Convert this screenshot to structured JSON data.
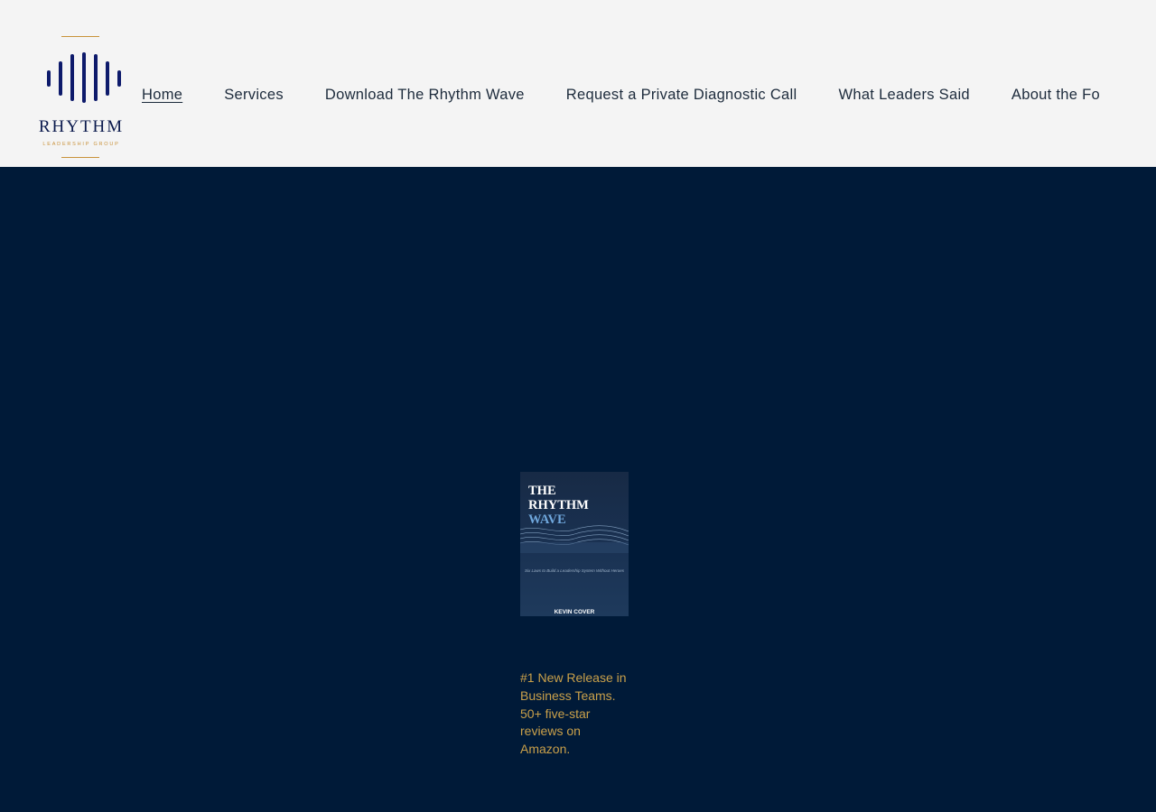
{
  "header": {
    "logo": {
      "wordmark": "RHYTHM",
      "subtitle": "LEADERSHIP GROUP",
      "accent_color": "#c9923a",
      "bar_color": "#0d1a6b"
    },
    "nav": [
      {
        "label": "Home",
        "active": true
      },
      {
        "label": "Services"
      },
      {
        "label": "Download The Rhythm Wave"
      },
      {
        "label": "Request a Private Diagnostic Call"
      },
      {
        "label": "What Leaders Said"
      },
      {
        "label": "About the Fo"
      }
    ]
  },
  "hero": {
    "background_color": "#001a38",
    "book": {
      "title_line1": "THE",
      "title_line2": "RHYTHM",
      "title_line3": "WAVE",
      "subtitle": "Six Laws to Build a Leadership System Without Heroes",
      "author": "KEVIN COVER"
    },
    "tagline": "#1 New Release in Business Teams. 50+ five-star reviews on Amazon.",
    "tagline_color": "#c9a04a"
  }
}
